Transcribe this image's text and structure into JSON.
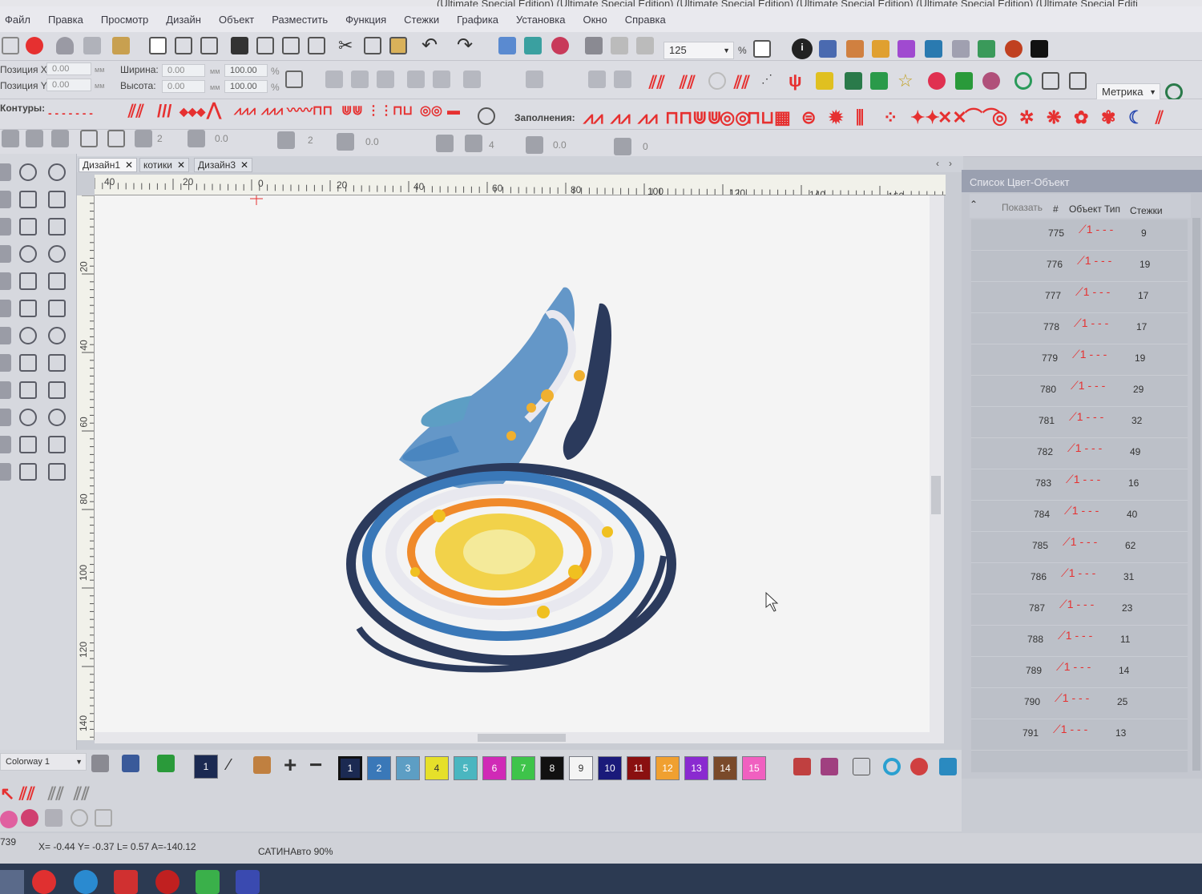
{
  "window": {
    "title_fragment": "(Ultimate Special Edition) (Ultimate Special Edition) (Ultimate Special Edition) (Ultimate Special Edition) (Ultimate Special Edition) (Ultimate Special Editi"
  },
  "menu": [
    "Файл",
    "Правка",
    "Просмотр",
    "Дизайн",
    "Объект",
    "Разместить",
    "Функция",
    "Стежки",
    "Графика",
    "Установка",
    "Окно",
    "Справка"
  ],
  "toolbar": {
    "zoom_value": "125",
    "zoom_unit": "%",
    "units_select": "Метрика"
  },
  "position": {
    "x_label": "Позиция X:",
    "x_value": "0.00",
    "y_label": "Позиция Y:",
    "y_value": "0.00",
    "unit": "мм",
    "width_label": "Ширина:",
    "width_value": "0.00",
    "height_label": "Высота:",
    "height_value": "0.00",
    "scale_x": "100.00",
    "scale_y": "100.00",
    "pct": "%"
  },
  "contours_label": "Контуры:",
  "fills_label": "Заполнения:",
  "params_row": [
    "2",
    "0.0",
    "2",
    "0.0",
    "4",
    "0.0",
    "0"
  ],
  "tabs": [
    {
      "label": "Дизайн1",
      "active": true
    },
    {
      "label": "котики",
      "active": false
    },
    {
      "label": "Дизайн3",
      "active": false
    }
  ],
  "ruler_h": [
    "40",
    "20",
    "0",
    "20",
    "40",
    "60",
    "80",
    "100",
    "120",
    "140",
    "160"
  ],
  "ruler_v": [
    "20",
    "40",
    "60",
    "80",
    "100",
    "120",
    "140"
  ],
  "panel": {
    "title": "Список Цвет-Объект",
    "col_show": "Показать",
    "col_num": "#",
    "col_obj": "Объект",
    "col_type": "Тип",
    "col_stitches": "Стежки",
    "rows": [
      {
        "num": "775",
        "stitches": "9"
      },
      {
        "num": "776",
        "stitches": "19"
      },
      {
        "num": "777",
        "stitches": "17"
      },
      {
        "num": "778",
        "stitches": "17"
      },
      {
        "num": "779",
        "stitches": "19"
      },
      {
        "num": "780",
        "stitches": "29"
      },
      {
        "num": "781",
        "stitches": "32"
      },
      {
        "num": "782",
        "stitches": "49"
      },
      {
        "num": "783",
        "stitches": "16"
      },
      {
        "num": "784",
        "stitches": "40"
      },
      {
        "num": "785",
        "stitches": "62"
      },
      {
        "num": "786",
        "stitches": "31"
      },
      {
        "num": "787",
        "stitches": "23"
      },
      {
        "num": "788",
        "stitches": "11"
      },
      {
        "num": "789",
        "stitches": "14"
      },
      {
        "num": "790",
        "stitches": "25"
      },
      {
        "num": "791",
        "stitches": "13"
      }
    ]
  },
  "colorway": {
    "name": "Colorway 1",
    "current": "1",
    "swatches": [
      {
        "n": "1",
        "color": "#1b2a52"
      },
      {
        "n": "2",
        "color": "#3a78b8"
      },
      {
        "n": "3",
        "color": "#5d9ec4"
      },
      {
        "n": "4",
        "color": "#e6e02a"
      },
      {
        "n": "5",
        "color": "#4ab6c0"
      },
      {
        "n": "6",
        "color": "#d02ab6"
      },
      {
        "n": "7",
        "color": "#3ec44a"
      },
      {
        "n": "8",
        "color": "#111111"
      },
      {
        "n": "9",
        "color": "#f4f4f4"
      },
      {
        "n": "10",
        "color": "#1a1a7a"
      },
      {
        "n": "11",
        "color": "#8a1010"
      },
      {
        "n": "12",
        "color": "#f0a030"
      },
      {
        "n": "13",
        "color": "#8a2ad0"
      },
      {
        "n": "14",
        "color": "#7a4a2a"
      },
      {
        "n": "15",
        "color": "#f060c0"
      }
    ]
  },
  "status": {
    "count": "739",
    "coords": "X=  -0.44 Y=  -0.37 L=   0.57 A=-140.12",
    "mode": "САТИНАвто 90%"
  },
  "accent": "#e63030"
}
